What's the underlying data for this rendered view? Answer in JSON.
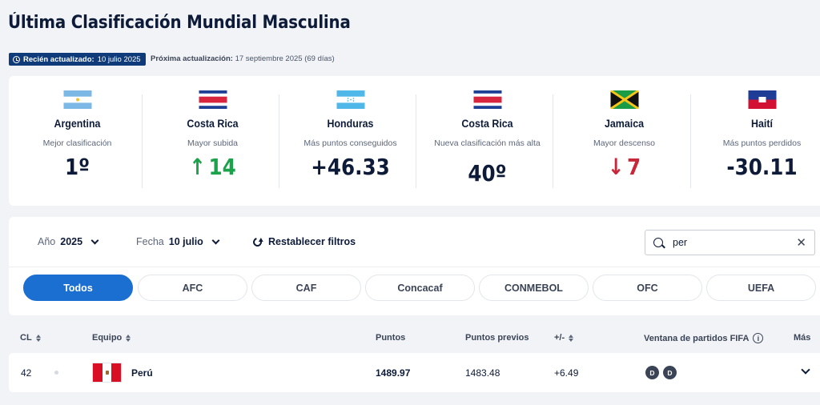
{
  "title": "Última Clasificación Mundial Masculina",
  "updated": {
    "label": "Recién actualizado:",
    "date": "10 julio 2025"
  },
  "next_update": {
    "label": "Próxima actualización:",
    "date": "17 septiembre 2025 (69 días)"
  },
  "highlights": [
    {
      "country": "Argentina",
      "description": "Mejor clasificación",
      "value": "1º",
      "flag": "argentina"
    },
    {
      "country": "Costa Rica",
      "description": "Mayor subida",
      "value": "14",
      "trend": "up",
      "flag": "costa-rica"
    },
    {
      "country": "Honduras",
      "description": "Más puntos conseguidos",
      "value": "+46.33",
      "flag": "honduras"
    },
    {
      "country": "Costa Rica",
      "description": "Nueva clasificación más alta",
      "value": "40º",
      "flag": "costa-rica"
    },
    {
      "country": "Jamaica",
      "description": "Mayor descenso",
      "value": "7",
      "trend": "down",
      "flag": "jamaica"
    },
    {
      "country": "Haití",
      "description": "Más puntos perdidos",
      "value": "-30.11",
      "flag": "haiti"
    }
  ],
  "filters": {
    "year_label": "Año",
    "year_value": "2025",
    "date_label": "Fecha",
    "date_value": "10 julio",
    "reset_label": "Restablecer filtros",
    "search_value": "per"
  },
  "confederations": [
    "Todos",
    "AFC",
    "CAF",
    "Concacaf",
    "CONMEBOL",
    "OFC",
    "UEFA"
  ],
  "active_confederation": "Todos",
  "table": {
    "headers": {
      "rank": "CL",
      "team": "Equipo",
      "points": "Puntos",
      "prev_points": "Puntos previos",
      "diff": "+/-",
      "window": "Ventana de partidos FIFA",
      "more": "Más"
    },
    "rows": [
      {
        "rank": "42",
        "team": "Perú",
        "points": "1489.97",
        "prev_points": "1483.48",
        "diff": "+6.49",
        "window": [
          "D",
          "D"
        ]
      }
    ]
  },
  "colors": {
    "accent": "#1a6fd1",
    "badge": "#0f3b7a",
    "up": "#1aa34a",
    "down": "#c8273a"
  }
}
